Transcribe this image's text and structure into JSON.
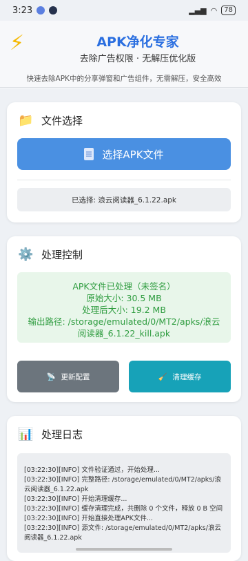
{
  "status_bar": {
    "time": "3:23",
    "battery": "78"
  },
  "header": {
    "logo_icon": "lightning-bolt-icon",
    "title": "APK净化专家",
    "subtitle": "去除广告权限 · 无解压优化版",
    "description": "快速去除APK中的分享弹窗和广告组件，无需解压，安全高效"
  },
  "file_select": {
    "title": "文件选择",
    "icon": "folder-icon",
    "button_label": "选择APK文件",
    "selected_text": "已选择: 浪云阅读器_6.1.22.apk"
  },
  "process_control": {
    "title": "处理控制",
    "icon": "gear-icon",
    "result_lines": [
      "APK文件已处理（未签名）",
      "原始大小: 30.5 MB",
      "处理后大小: 19.2 MB",
      "输出路径: /storage/emulated/0/MT2/apks/浪云",
      "阅读器_6.1.22_kill.apk"
    ],
    "update_config_label": "更新配置",
    "clear_cache_label": "清理缓存",
    "colors": {
      "result_text": "#2e9c3f",
      "gray_button": "#6c757d",
      "teal_button": "#17a2b8"
    }
  },
  "log": {
    "title": "处理日志",
    "icon": "bar-chart-icon",
    "lines": [
      "[03:22:30][INFO] 文件验证通过，开始处理...",
      "[03:22:30][INFO] 完整路径: /storage/emulated/0/MT2/apks/浪云阅读器_6.1.22.apk",
      "[03:22:30][INFO] 开始清理缓存...",
      "[03:22:30][INFO] 缓存清理完成，共删除 0 个文件，释放 0 B 空间",
      "[03:22:30][INFO] 开始直接处理APK文件...",
      "[03:22:30][INFO] 源文件: /storage/emulated/0/MT2/apks/浪云阅读器_6.1.22.apk"
    ]
  },
  "colors": {
    "accent": "#4a90e2",
    "title_blue": "#2b6fe0"
  }
}
